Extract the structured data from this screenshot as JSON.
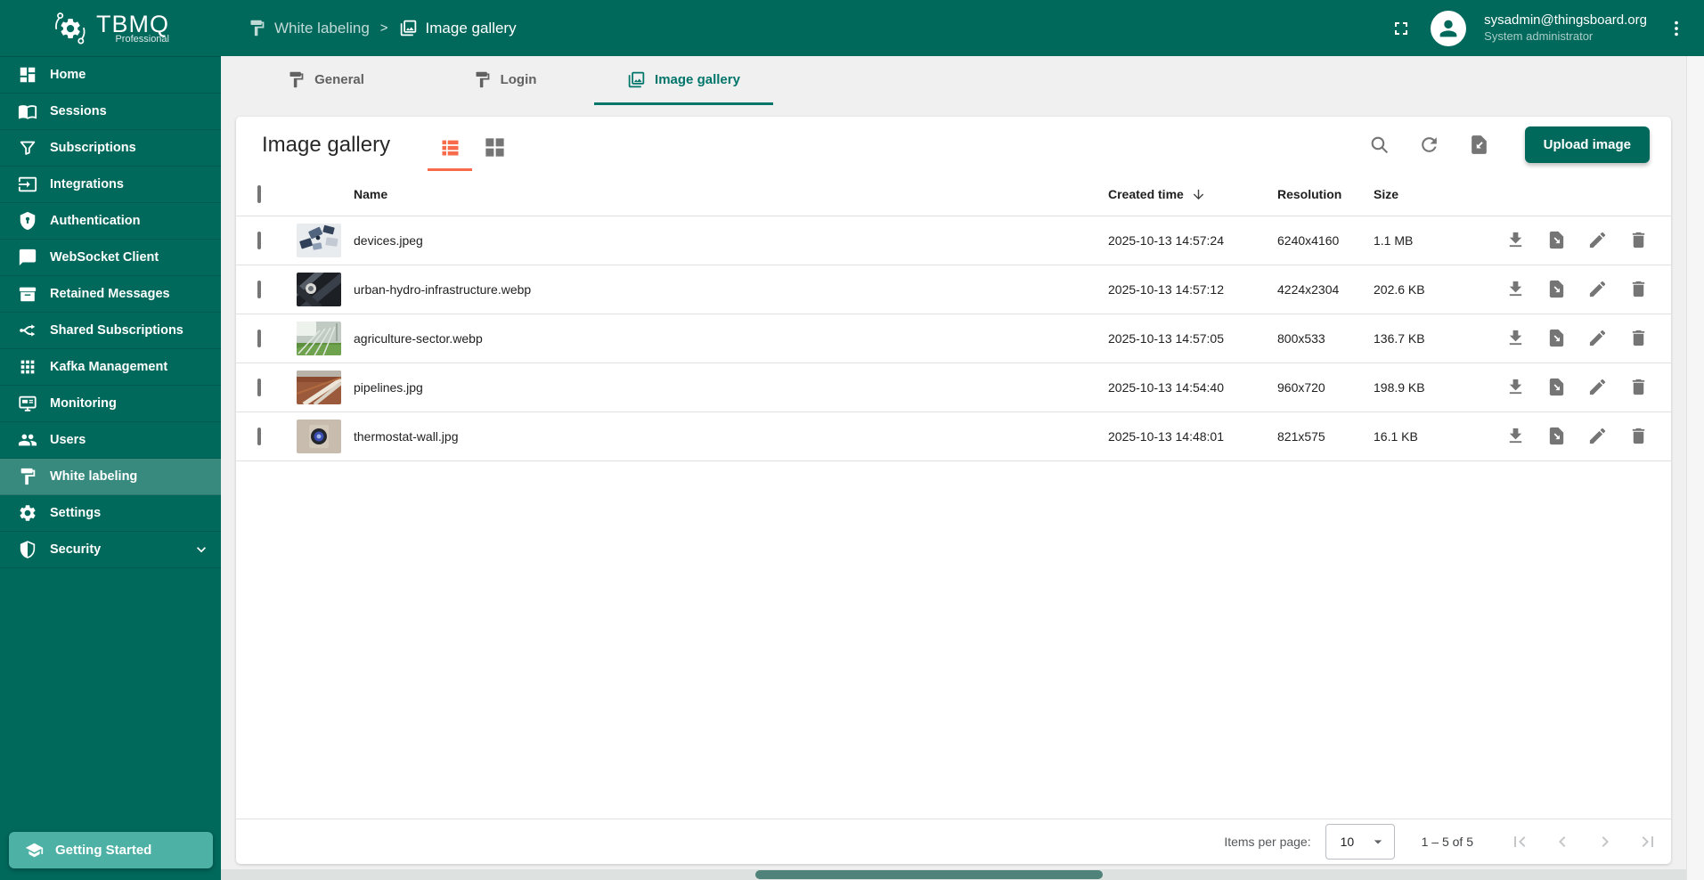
{
  "colors": {
    "primary": "#00695C",
    "accent": "#F76A4A",
    "tab_active": "#00756A"
  },
  "app": {
    "logo_title": "TBMQ",
    "logo_subtitle": "Professional",
    "logo_icon": "tbmq-gear-logo-icon"
  },
  "header": {
    "breadcrumb": [
      {
        "icon": "paint-roller-icon",
        "label": "White labeling"
      },
      {
        "icon": "image-gallery-icon",
        "label": "Image gallery"
      }
    ],
    "separator": ">",
    "icons": {
      "fullscreen": "fullscreen-icon",
      "avatar": "person-icon",
      "menu": "more-vert-icon"
    },
    "user": {
      "email": "sysadmin@thingsboard.org",
      "role": "System administrator"
    }
  },
  "sidebar": {
    "items": [
      {
        "icon": "dashboard-icon",
        "label": "Home"
      },
      {
        "icon": "book-icon",
        "label": "Sessions"
      },
      {
        "icon": "filter-icon",
        "label": "Subscriptions"
      },
      {
        "icon": "input-icon",
        "label": "Integrations"
      },
      {
        "icon": "shield-lock-icon",
        "label": "Authentication"
      },
      {
        "icon": "chat-icon",
        "label": "WebSocket Client"
      },
      {
        "icon": "archive-icon",
        "label": "Retained Messages"
      },
      {
        "icon": "call-split-icon",
        "label": "Shared Subscriptions"
      },
      {
        "icon": "apps-grid-icon",
        "label": "Kafka Management"
      },
      {
        "icon": "monitor-icon",
        "label": "Monitoring"
      },
      {
        "icon": "people-icon",
        "label": "Users"
      },
      {
        "icon": "paint-roller-icon",
        "label": "White labeling",
        "active": true
      },
      {
        "icon": "gear-icon",
        "label": "Settings"
      },
      {
        "icon": "shield-icon",
        "label": "Security",
        "has_chevron": true
      }
    ],
    "getting_started": {
      "icon": "school-icon",
      "label": "Getting Started"
    }
  },
  "tabs": [
    {
      "icon": "paint-roller-icon",
      "label": "General",
      "active": false
    },
    {
      "icon": "paint-roller-icon",
      "label": "Login",
      "active": false
    },
    {
      "icon": "image-gallery-icon",
      "label": "Image gallery",
      "active": true
    }
  ],
  "gallery": {
    "title": "Image gallery",
    "view_modes": [
      {
        "icon": "list-view-icon",
        "active": true
      },
      {
        "icon": "grid-view-icon",
        "active": false
      }
    ],
    "toolbar_icons": [
      "search-icon",
      "refresh-icon",
      "import-file-icon"
    ],
    "upload_button": "Upload image",
    "table": {
      "columns": [
        "Name",
        "Created time",
        "Resolution",
        "Size"
      ],
      "sort": {
        "column": "Created time",
        "direction": "desc"
      },
      "rows": [
        {
          "thumb": "devices",
          "name": "devices.jpeg",
          "created": "2025-10-13 14:57:24",
          "resolution": "6240x4160",
          "size": "1.1 MB"
        },
        {
          "thumb": "hydro",
          "name": "urban-hydro-infrastructure.webp",
          "created": "2025-10-13 14:57:12",
          "resolution": "4224x2304",
          "size": "202.6 KB"
        },
        {
          "thumb": "agriculture",
          "name": "agriculture-sector.webp",
          "created": "2025-10-13 14:57:05",
          "resolution": "800x533",
          "size": "136.7 KB"
        },
        {
          "thumb": "pipelines",
          "name": "pipelines.jpg",
          "created": "2025-10-13 14:54:40",
          "resolution": "960x720",
          "size": "198.9 KB"
        },
        {
          "thumb": "thermostat",
          "name": "thermostat-wall.jpg",
          "created": "2025-10-13 14:48:01",
          "resolution": "821x575",
          "size": "16.1 KB"
        }
      ],
      "row_actions": [
        "download-icon",
        "export-file-icon",
        "edit-icon",
        "delete-icon"
      ]
    },
    "pagination": {
      "items_per_page_label": "Items per page:",
      "items_per_page_value": "10",
      "range_label": "1 – 5 of 5",
      "nav_icons": [
        "first-page-icon",
        "prev-page-icon",
        "next-page-icon",
        "last-page-icon"
      ]
    }
  }
}
